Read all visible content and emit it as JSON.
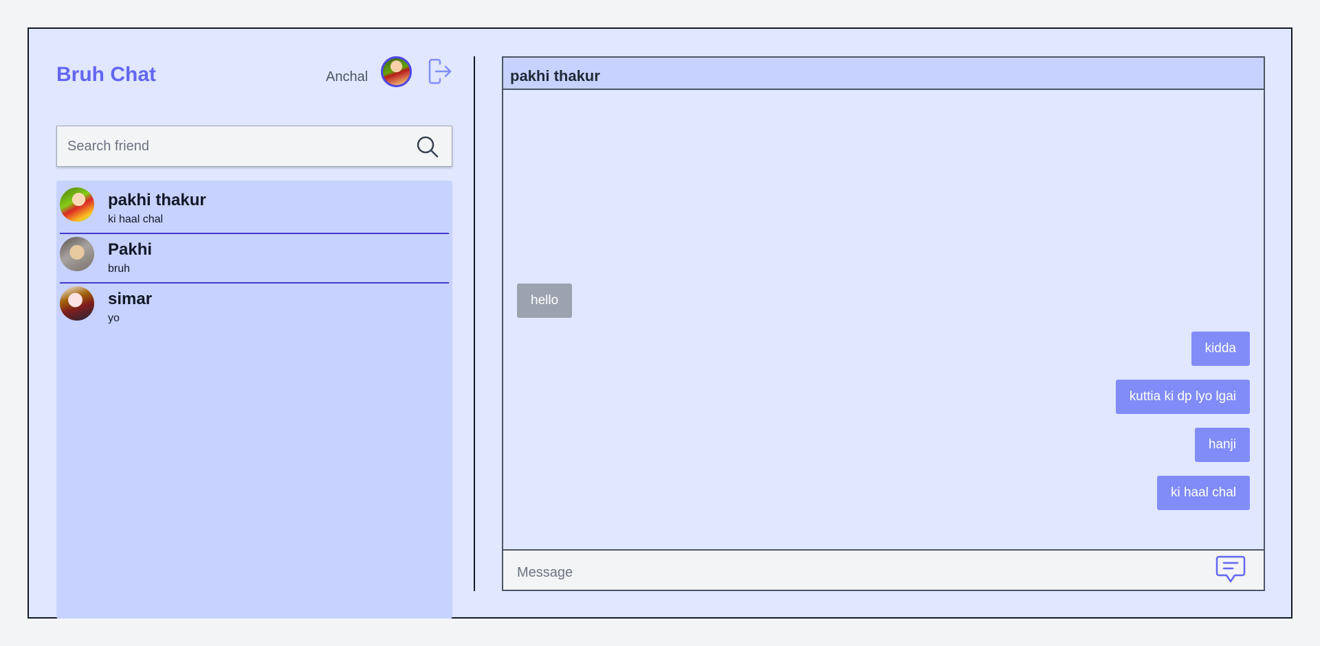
{
  "app": {
    "title": "Bruh Chat"
  },
  "user": {
    "name": "Anchal",
    "avatar_icon": "user-avatar"
  },
  "search": {
    "placeholder": "Search friend"
  },
  "contacts": [
    {
      "name": "pakhi thakur",
      "last_message": "ki haal chal"
    },
    {
      "name": "Pakhi",
      "last_message": "bruh"
    },
    {
      "name": "simar",
      "last_message": "yo"
    }
  ],
  "chat": {
    "title": "pakhi thakur",
    "messages": [
      {
        "text": "hello",
        "direction": "incoming"
      },
      {
        "text": "kidda",
        "direction": "outgoing"
      },
      {
        "text": "kuttia ki dp lyo lgai",
        "direction": "outgoing"
      },
      {
        "text": "hanji",
        "direction": "outgoing"
      },
      {
        "text": "ki haal chal",
        "direction": "outgoing"
      }
    ],
    "composer_placeholder": "Message"
  },
  "colors": {
    "accent": "#6366f1",
    "panel": "#c7d2fe",
    "background": "#e0e7ff",
    "outgoing_bubble": "#818cf8",
    "incoming_bubble": "#9ca3af"
  },
  "icons": {
    "logout": "logout-icon",
    "search": "search-icon",
    "send": "chat-bubble-icon"
  }
}
